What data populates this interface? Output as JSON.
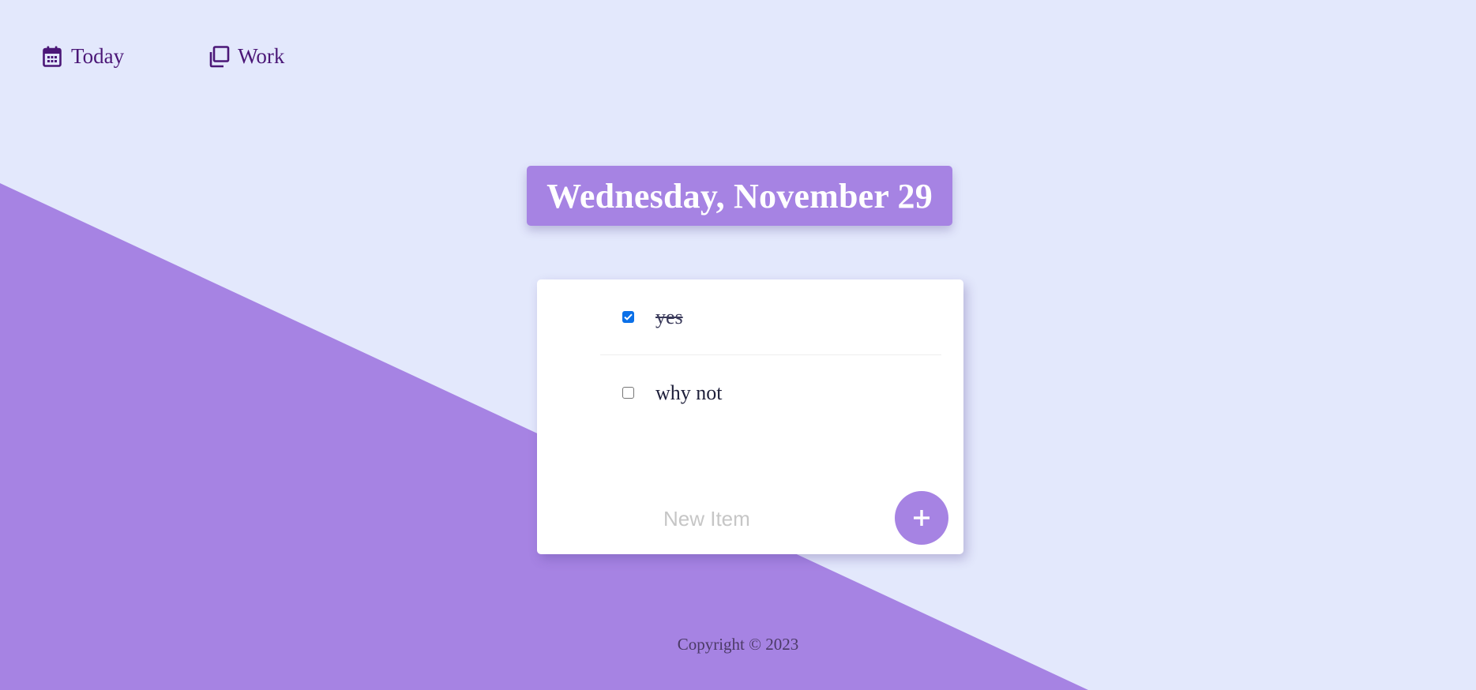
{
  "nav": {
    "items": [
      {
        "label": "Today",
        "icon": "calendar-icon"
      },
      {
        "label": "Work",
        "icon": "copy-icon"
      }
    ]
  },
  "header": {
    "date": "Wednesday, November 29"
  },
  "todo": {
    "items": [
      {
        "text": "yes",
        "checked": true
      },
      {
        "text": "why not",
        "checked": false
      }
    ],
    "new_item_placeholder": "New Item",
    "add_label": "+"
  },
  "footer": {
    "copyright": "Copyright © 2023"
  },
  "colors": {
    "background": "#e3e8fc",
    "accent": "#a683e3",
    "nav_text": "#4b1777",
    "checkbox_checked": "#0b70e8"
  }
}
